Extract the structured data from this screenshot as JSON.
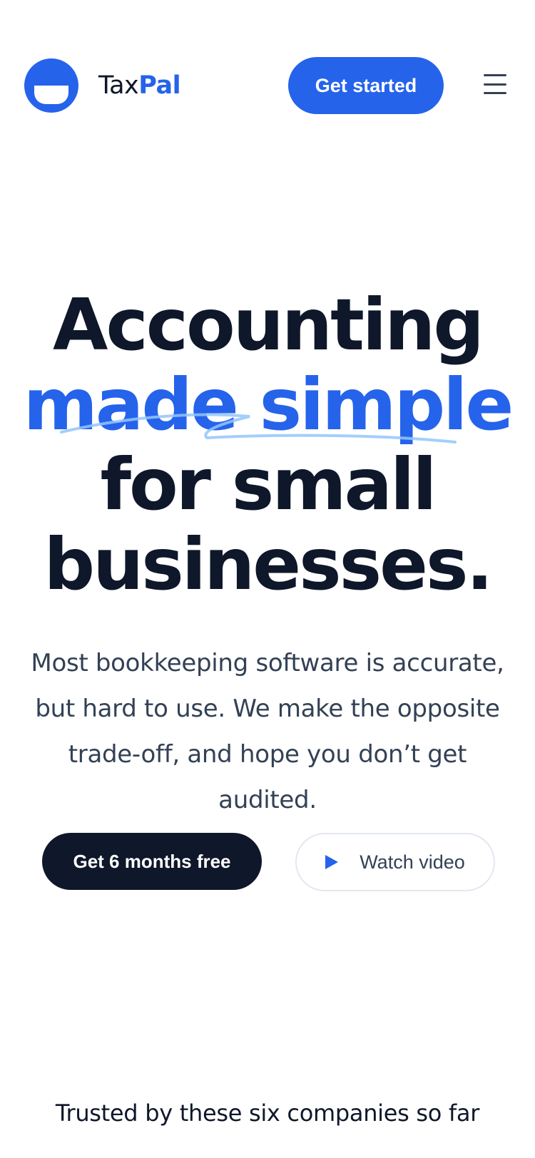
{
  "header": {
    "logo_text_main": "Tax",
    "logo_text_accent": "Pal",
    "get_started_label": "Get started",
    "menu_icon": "hamburger-menu-icon"
  },
  "hero": {
    "title_line1": "Accounting",
    "title_line2": "made simple",
    "title_line3": "for small",
    "title_line4": "businesses.",
    "subtitle_line1": "Most bookkeeping software is accurate,",
    "subtitle_line2": "but hard to use. We make the opposite",
    "subtitle_line3": "trade-off, and hope you don’t get audited."
  },
  "cta": {
    "primary_label": "Get 6 months free",
    "secondary_label": "Watch video",
    "secondary_icon": "play-icon"
  },
  "trusted": {
    "heading": "Trusted by these six companies so far"
  },
  "colors": {
    "accent": "#2563eb",
    "dark": "#0f172a",
    "text": "#334155",
    "border": "#e2e8f0",
    "underline": "#bfdbfe"
  }
}
